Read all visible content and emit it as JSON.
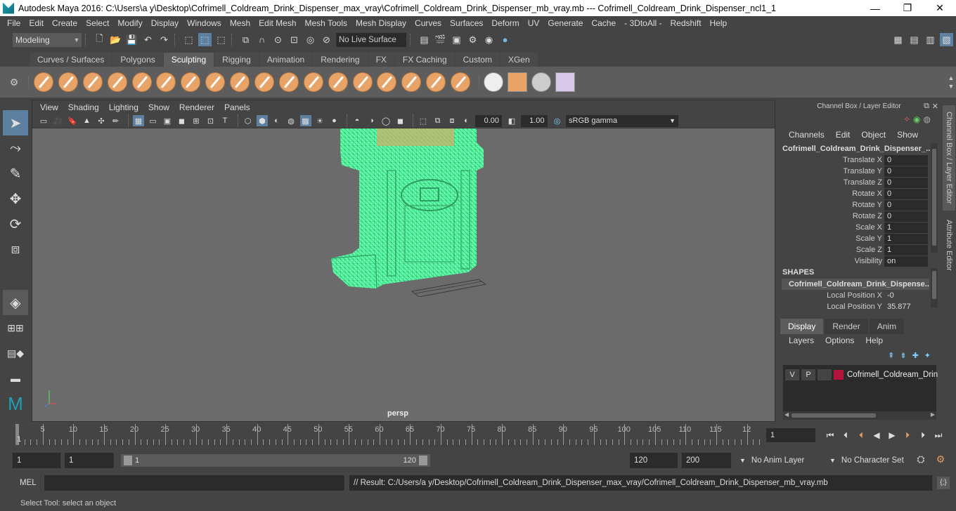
{
  "window": {
    "title": "Autodesk Maya 2016: C:\\Users\\a y\\Desktop\\Cofrimell_Coldream_Drink_Dispenser_max_vray\\Cofrimell_Coldream_Drink_Dispenser_mb_vray.mb   ---   Cofrimell_Coldream_Drink_Dispenser_ncl1_1",
    "minimize": "—",
    "maximize": "❐",
    "close": "✕"
  },
  "menubar": [
    "File",
    "Edit",
    "Create",
    "Select",
    "Modify",
    "Display",
    "Windows",
    "Mesh",
    "Edit Mesh",
    "Mesh Tools",
    "Mesh Display",
    "Curves",
    "Surfaces",
    "Deform",
    "UV",
    "Generate",
    "Cache",
    "- 3DtoAll -",
    "Redshift",
    "Help"
  ],
  "statusline": {
    "mode": "Modeling",
    "live_surface": "No Live Surface"
  },
  "shelf_tabs": [
    "Curves / Surfaces",
    "Polygons",
    "Sculpting",
    "Rigging",
    "Animation",
    "Rendering",
    "FX",
    "FX Caching",
    "Custom",
    "XGen"
  ],
  "active_shelf_tab": "Sculpting",
  "viewport": {
    "menu": [
      "View",
      "Shading",
      "Lighting",
      "Show",
      "Renderer",
      "Panels"
    ],
    "exposure": "0.00",
    "gamma_value": "1.00",
    "color_space": "sRGB gamma",
    "camera_label": "persp",
    "mesh_color": "#5effa8"
  },
  "channel_box": {
    "title": "Channel Box / Layer Editor",
    "menu": [
      "Channels",
      "Edit",
      "Object",
      "Show"
    ],
    "object_name": "Cofrimell_Coldream_Drink_Dispenser_...",
    "channels": [
      {
        "label": "Translate X",
        "value": "0"
      },
      {
        "label": "Translate Y",
        "value": "0"
      },
      {
        "label": "Translate Z",
        "value": "0"
      },
      {
        "label": "Rotate X",
        "value": "0"
      },
      {
        "label": "Rotate Y",
        "value": "0"
      },
      {
        "label": "Rotate Z",
        "value": "0"
      },
      {
        "label": "Scale X",
        "value": "1"
      },
      {
        "label": "Scale Y",
        "value": "1"
      },
      {
        "label": "Scale Z",
        "value": "1"
      },
      {
        "label": "Visibility",
        "value": "on"
      }
    ],
    "shapes_header": "SHAPES",
    "shape_name": "Cofrimell_Coldream_Drink_Dispense...",
    "shape_channels": [
      {
        "label": "Local Position X",
        "value": "-0"
      },
      {
        "label": "Local Position Y",
        "value": "35.877"
      }
    ]
  },
  "layer_editor": {
    "tabs": [
      "Display",
      "Render",
      "Anim"
    ],
    "active_tab": "Display",
    "menu": [
      "Layers",
      "Options",
      "Help"
    ],
    "layer": {
      "v": "V",
      "p": "P",
      "name": "Cofrimell_Coldream_Drin",
      "color": "#b0143a"
    }
  },
  "side_tabs": [
    "Channel Box / Layer Editor",
    "Attribute Editor"
  ],
  "timeline": {
    "ticks": [
      "5",
      "10",
      "15",
      "20",
      "25",
      "30",
      "35",
      "40",
      "45",
      "50",
      "55",
      "60",
      "65",
      "70",
      "75",
      "80",
      "85",
      "90",
      "95",
      "100",
      "105",
      "110",
      "115",
      "12"
    ],
    "start_marker": "1",
    "current_frame": "1"
  },
  "range": {
    "start": "1",
    "playback_start": "1",
    "slider_start": "1",
    "slider_end": "120",
    "playback_end": "120",
    "end": "200",
    "anim_layer": "No Anim Layer",
    "character_set": "No Character Set"
  },
  "command_line": {
    "label": "MEL",
    "result": "// Result: C:/Users/a y/Desktop/Cofrimell_Coldream_Drink_Dispenser_max_vray/Cofrimell_Coldream_Drink_Dispenser_mb_vray.mb"
  },
  "help_line": "Select Tool: select an object"
}
